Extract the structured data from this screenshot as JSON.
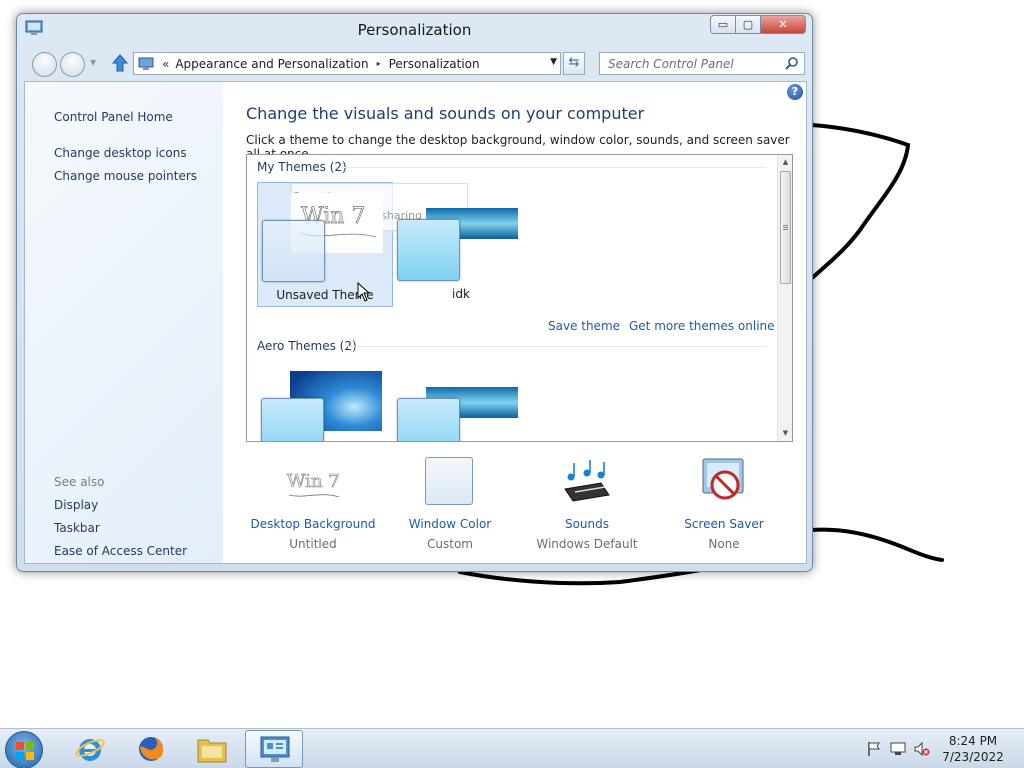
{
  "window": {
    "title": "Personalization",
    "caption": {
      "minimize": "▭",
      "maximize": "▢",
      "close": "✕"
    }
  },
  "address": {
    "prefix": "«",
    "crumbs": [
      "Appearance and Personalization",
      "Personalization"
    ],
    "separator": "▸",
    "dropdown": "▼",
    "refresh": "⇆"
  },
  "search": {
    "placeholder": "Search Control Panel"
  },
  "sidebar": {
    "home": "Control Panel Home",
    "links": [
      "Change desktop icons",
      "Change mouse pointers"
    ],
    "see_also_heading": "See also",
    "see_also": [
      "Display",
      "Taskbar",
      "Ease of Access Center"
    ]
  },
  "main": {
    "help": "?",
    "heading": "Change the visuals and sounds on your computer",
    "subtext": "Click a theme to change the desktop background, window color, sounds, and screen saver all at once.",
    "my_themes": {
      "title": "My Themes (2)",
      "items": [
        {
          "label": "Unsaved Theme",
          "selected": true
        },
        {
          "label": "idk",
          "selected": false
        }
      ],
      "context_menu": [
        "Save theme",
        "Save theme for sharing"
      ],
      "actions": [
        "Save theme",
        "Get more themes online"
      ]
    },
    "aero_themes": {
      "title": "Aero Themes (2)"
    },
    "thumbnail_text": "Win 7"
  },
  "bottom": [
    {
      "label": "Desktop Background",
      "value": "Untitled",
      "icon": "win7-sketch-icon"
    },
    {
      "label": "Window Color",
      "value": "Custom",
      "icon": "window-color-icon"
    },
    {
      "label": "Sounds",
      "value": "Windows Default",
      "icon": "music-notes-icon"
    },
    {
      "label": "Screen Saver",
      "value": "None",
      "icon": "screen-saver-none-icon"
    }
  ],
  "taskbar": {
    "apps": [
      "internet-explorer-icon",
      "firefox-icon",
      "file-explorer-icon",
      "control-panel-icon"
    ],
    "tray": [
      "action-center-flag-icon",
      "network-icon",
      "volume-muted-icon"
    ],
    "time": "8:24 PM",
    "date": "7/23/2022"
  },
  "colors": {
    "link": "#1e5aa6",
    "heading": "#1e3e72",
    "close_button": "#c7463a"
  }
}
